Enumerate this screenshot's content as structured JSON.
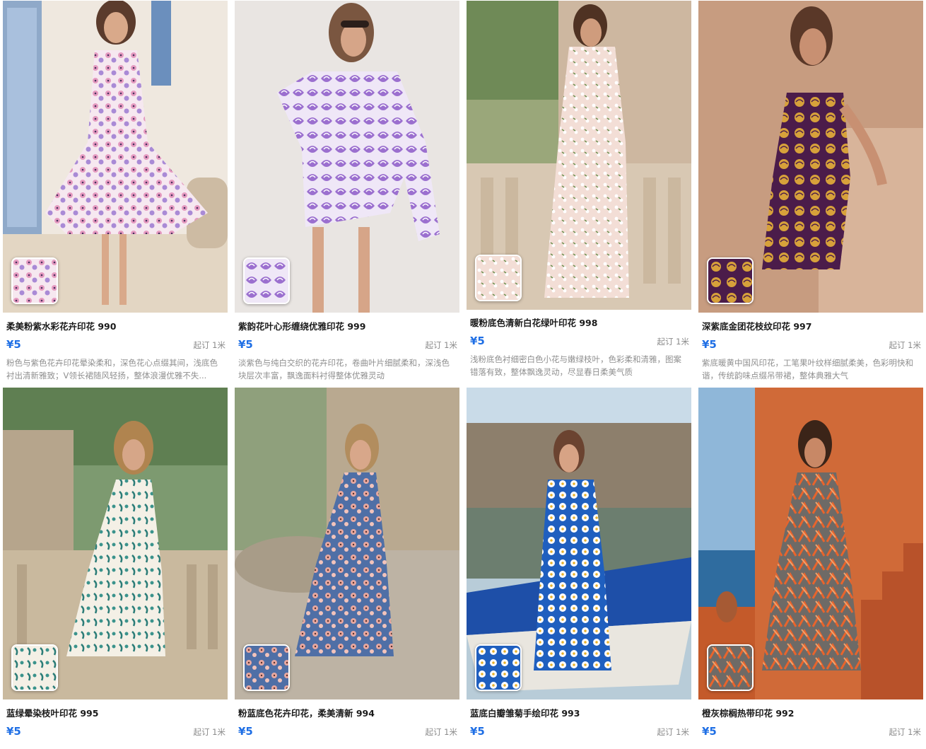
{
  "products": [
    {
      "title": "柔美粉紫水彩花卉印花 990",
      "price": "¥5",
      "moq": "起订 1米",
      "desc": "粉色与紫色花卉印花晕染柔和，深色花心点缀其间，浅底色衬出清新雅致；V领长裙随风轻扬，整体浪漫优雅不失..."
    },
    {
      "title": "紫韵花叶心形缠绕优雅印花 999",
      "price": "¥5",
      "moq": "起订 1米",
      "desc": "淡紫色与纯白交织的花卉印花，卷曲叶片细腻柔和，深浅色块层次丰富，飘逸面料衬得整体优雅灵动"
    },
    {
      "title": "暖粉底色清新白花绿叶印花 998",
      "price": "¥5",
      "moq": "起订 1米",
      "desc": "浅粉底色衬细密白色小花与嫩绿枝叶，色彩柔和清雅，图案错落有致，整体飘逸灵动，尽显春日柔美气质"
    },
    {
      "title": "深紫底金团花枝纹印花 997",
      "price": "¥5",
      "moq": "起订 1米",
      "desc": "紫底暖黄中国风印花，工笔果叶纹样细腻柔美，色彩明快和谐，传统韵味点缀吊带裙，整体典雅大气"
    },
    {
      "title": "蓝绿晕染枝叶印花 995",
      "price": "¥5",
      "moq": "起订 1米",
      "desc": ""
    },
    {
      "title": "粉蓝底色花卉印花，柔美清新 994",
      "price": "¥5",
      "moq": "起订 1米",
      "desc": ""
    },
    {
      "title": "蓝底白瓣雏菊手绘印花 993",
      "price": "¥5",
      "moq": "起订 1米",
      "desc": ""
    },
    {
      "title": "橙灰棕榈热带印花 992",
      "price": "¥5",
      "moq": "起订 1米",
      "desc": ""
    }
  ]
}
